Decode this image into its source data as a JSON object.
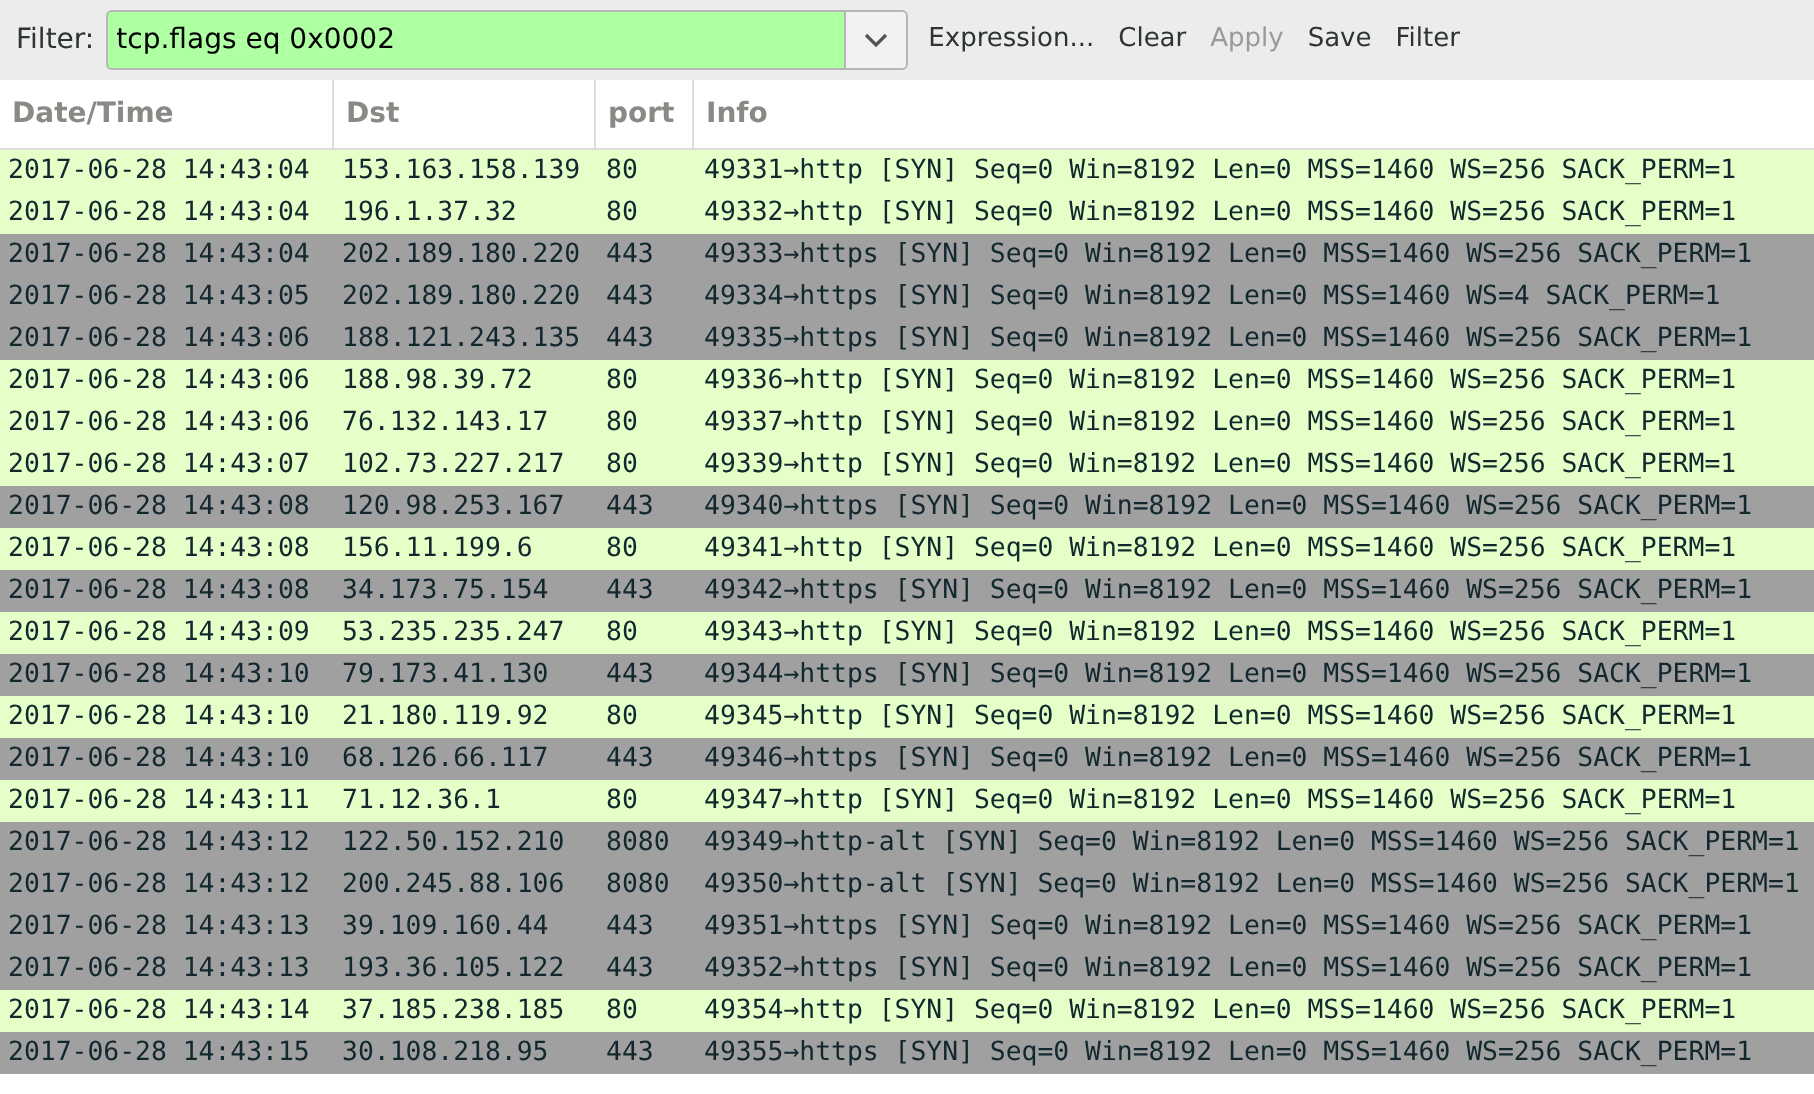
{
  "filter_bar": {
    "label": "Filter:",
    "value": "tcp.flags eq 0x0002",
    "buttons": [
      {
        "label": "Expression...",
        "disabled": false
      },
      {
        "label": "Clear",
        "disabled": false
      },
      {
        "label": "Apply",
        "disabled": true
      },
      {
        "label": "Save",
        "disabled": false
      },
      {
        "label": "Filter",
        "disabled": false
      }
    ]
  },
  "table": {
    "columns": [
      "Date/Time",
      "Dst",
      "port",
      "Info"
    ],
    "rows": [
      {
        "cells": [
          "2017-06-28 14:43:04",
          "153.163.158.139",
          "80",
          "49331→http [SYN] Seq=0 Win=8192 Len=0 MSS=1460 WS=256 SACK_PERM=1"
        ],
        "color": "#e4ffc7"
      },
      {
        "cells": [
          "2017-06-28 14:43:04",
          "196.1.37.32",
          "80",
          "49332→http [SYN] Seq=0 Win=8192 Len=0 MSS=1460 WS=256 SACK_PERM=1"
        ],
        "color": "#e4ffc7"
      },
      {
        "cells": [
          "2017-06-28 14:43:04",
          "202.189.180.220",
          "443",
          "49333→https [SYN] Seq=0 Win=8192 Len=0 MSS=1460 WS=256 SACK_PERM=1"
        ],
        "color": "#a0a0a0"
      },
      {
        "cells": [
          "2017-06-28 14:43:05",
          "202.189.180.220",
          "443",
          "49334→https [SYN] Seq=0 Win=8192 Len=0 MSS=1460 WS=4 SACK_PERM=1"
        ],
        "color": "#a0a0a0"
      },
      {
        "cells": [
          "2017-06-28 14:43:06",
          "188.121.243.135",
          "443",
          "49335→https [SYN] Seq=0 Win=8192 Len=0 MSS=1460 WS=256 SACK_PERM=1"
        ],
        "color": "#a0a0a0"
      },
      {
        "cells": [
          "2017-06-28 14:43:06",
          "188.98.39.72",
          "80",
          "49336→http [SYN] Seq=0 Win=8192 Len=0 MSS=1460 WS=256 SACK_PERM=1"
        ],
        "color": "#e4ffc7"
      },
      {
        "cells": [
          "2017-06-28 14:43:06",
          "76.132.143.17",
          "80",
          "49337→http [SYN] Seq=0 Win=8192 Len=0 MSS=1460 WS=256 SACK_PERM=1"
        ],
        "color": "#e4ffc7"
      },
      {
        "cells": [
          "2017-06-28 14:43:07",
          "102.73.227.217",
          "80",
          "49339→http [SYN] Seq=0 Win=8192 Len=0 MSS=1460 WS=256 SACK_PERM=1"
        ],
        "color": "#e4ffc7"
      },
      {
        "cells": [
          "2017-06-28 14:43:08",
          "120.98.253.167",
          "443",
          "49340→https [SYN] Seq=0 Win=8192 Len=0 MSS=1460 WS=256 SACK_PERM=1"
        ],
        "color": "#a0a0a0"
      },
      {
        "cells": [
          "2017-06-28 14:43:08",
          "156.11.199.6",
          "80",
          "49341→http [SYN] Seq=0 Win=8192 Len=0 MSS=1460 WS=256 SACK_PERM=1"
        ],
        "color": "#e4ffc7"
      },
      {
        "cells": [
          "2017-06-28 14:43:08",
          "34.173.75.154",
          "443",
          "49342→https [SYN] Seq=0 Win=8192 Len=0 MSS=1460 WS=256 SACK_PERM=1"
        ],
        "color": "#a0a0a0"
      },
      {
        "cells": [
          "2017-06-28 14:43:09",
          "53.235.235.247",
          "80",
          "49343→http [SYN] Seq=0 Win=8192 Len=0 MSS=1460 WS=256 SACK_PERM=1"
        ],
        "color": "#e4ffc7"
      },
      {
        "cells": [
          "2017-06-28 14:43:10",
          "79.173.41.130",
          "443",
          "49344→https [SYN] Seq=0 Win=8192 Len=0 MSS=1460 WS=256 SACK_PERM=1"
        ],
        "color": "#a0a0a0"
      },
      {
        "cells": [
          "2017-06-28 14:43:10",
          "21.180.119.92",
          "80",
          "49345→http [SYN] Seq=0 Win=8192 Len=0 MSS=1460 WS=256 SACK_PERM=1"
        ],
        "color": "#e4ffc7"
      },
      {
        "cells": [
          "2017-06-28 14:43:10",
          "68.126.66.117",
          "443",
          "49346→https [SYN] Seq=0 Win=8192 Len=0 MSS=1460 WS=256 SACK_PERM=1"
        ],
        "color": "#a0a0a0"
      },
      {
        "cells": [
          "2017-06-28 14:43:11",
          "71.12.36.1",
          "80",
          "49347→http [SYN] Seq=0 Win=8192 Len=0 MSS=1460 WS=256 SACK_PERM=1"
        ],
        "color": "#e4ffc7"
      },
      {
        "cells": [
          "2017-06-28 14:43:12",
          "122.50.152.210",
          "8080",
          "49349→http-alt [SYN] Seq=0 Win=8192 Len=0 MSS=1460 WS=256 SACK_PERM=1"
        ],
        "color": "#a0a0a0"
      },
      {
        "cells": [
          "2017-06-28 14:43:12",
          "200.245.88.106",
          "8080",
          "49350→http-alt [SYN] Seq=0 Win=8192 Len=0 MSS=1460 WS=256 SACK_PERM=1"
        ],
        "color": "#a0a0a0"
      },
      {
        "cells": [
          "2017-06-28 14:43:13",
          "39.109.160.44",
          "443",
          "49351→https [SYN] Seq=0 Win=8192 Len=0 MSS=1460 WS=256 SACK_PERM=1"
        ],
        "color": "#a0a0a0"
      },
      {
        "cells": [
          "2017-06-28 14:43:13",
          "193.36.105.122",
          "443",
          "49352→https [SYN] Seq=0 Win=8192 Len=0 MSS=1460 WS=256 SACK_PERM=1"
        ],
        "color": "#a0a0a0"
      },
      {
        "cells": [
          "2017-06-28 14:43:14",
          "37.185.238.185",
          "80",
          "49354→http [SYN] Seq=0 Win=8192 Len=0 MSS=1460 WS=256 SACK_PERM=1"
        ],
        "color": "#e4ffc7"
      },
      {
        "cells": [
          "2017-06-28 14:43:15",
          "30.108.218.95",
          "443",
          "49355→https [SYN] Seq=0 Win=8192 Len=0 MSS=1460 WS=256 SACK_PERM=1"
        ],
        "color": "#a0a0a0"
      }
    ]
  }
}
